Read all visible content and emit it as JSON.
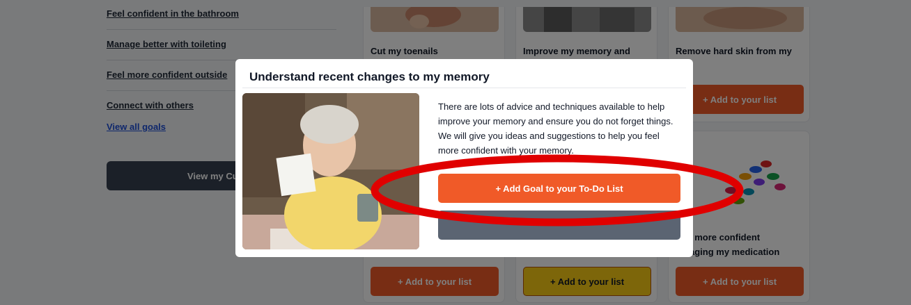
{
  "goals": {
    "items": [
      {
        "label": "Feel confident in the bathroom"
      },
      {
        "label": "Manage better with toileting"
      },
      {
        "label": "Feel more confident outside"
      },
      {
        "label": "Connect with others"
      }
    ],
    "view_all": "View all goals",
    "view_current": "View my Curren"
  },
  "cards": [
    {
      "title": "Cut my toenails",
      "button": "+ Add to your list"
    },
    {
      "title": "Improve my memory and",
      "button": "+ Add to your list"
    },
    {
      "title": "Remove hard skin from my",
      "button": "+ Add to your list"
    },
    {
      "title_line1": "l more confident",
      "title_line2": "aging my medication",
      "button": "+ Add to your list"
    }
  ],
  "modal": {
    "title": "Understand recent changes to my memory",
    "body": "There are lots of advice and techniques available to help improve your memory and ensure you do not forget things. We will give you ideas and suggestions to help you feel more confident with your memory.",
    "primary_button": "+ Add Goal to your To-Do List"
  },
  "colors": {
    "accent": "#f05a28",
    "secondary_button": "#5b6472",
    "annotation": "#e00000",
    "highlight_button": "#facc15"
  }
}
